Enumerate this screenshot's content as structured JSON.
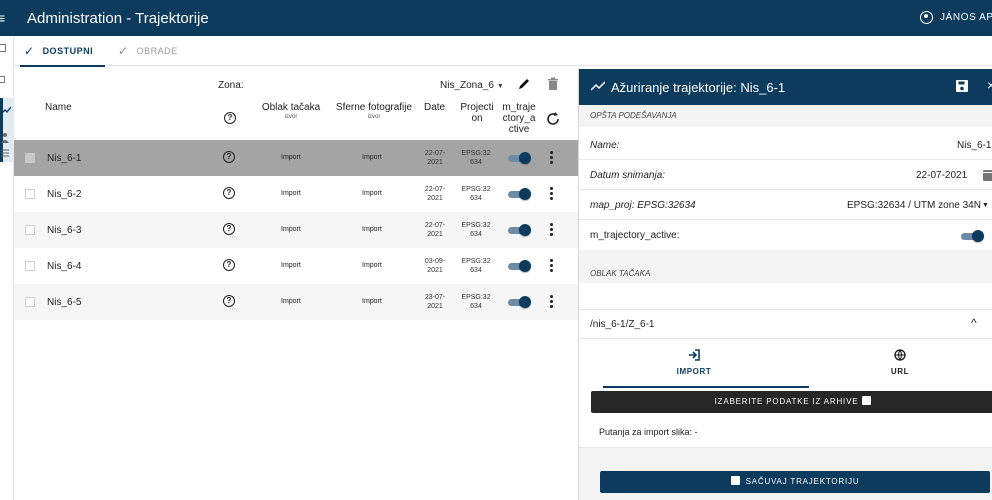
{
  "app": {
    "title": "Administration - Trajektorije",
    "user": "JÁNOS APR",
    "menu_icon": "≡"
  },
  "tabs": [
    {
      "label": "DOSTUPNI",
      "active": true
    },
    {
      "label": "OBRADE",
      "active": false
    }
  ],
  "table": {
    "zona_label": "Zona:",
    "zona_value": "Nis_Zona_6",
    "headers": {
      "name": "Name",
      "oblak": "Oblak tačaka",
      "oblak_sub": "izvor",
      "sferne": "Sferne fotografije",
      "sferne_sub": "izvor",
      "date": "Date",
      "projection": "Projecti on",
      "active": "m_traje ctory_a ctive"
    },
    "help_glyph": "?",
    "rows": [
      {
        "name": "Nis_6-1",
        "oblak": "Import",
        "sferne": "Import",
        "date_a": "22-07-",
        "date_b": "2021",
        "epsg_a": "EPSG:32",
        "epsg_b": "634",
        "active": true,
        "selected": true
      },
      {
        "name": "Nis_6-2",
        "oblak": "Import",
        "sferne": "Import",
        "date_a": "22-07-",
        "date_b": "2021",
        "epsg_a": "EPSG:32",
        "epsg_b": "634",
        "active": true
      },
      {
        "name": "Nis_6-3",
        "oblak": "Import",
        "sferne": "Import",
        "date_a": "22-07-",
        "date_b": "2021",
        "epsg_a": "EPSG:32",
        "epsg_b": "634",
        "active": true
      },
      {
        "name": "Nis_6-4",
        "oblak": "Import",
        "sferne": "Import",
        "date_a": "03-09-",
        "date_b": "2021",
        "epsg_a": "EPSG:32",
        "epsg_b": "634",
        "active": true
      },
      {
        "name": "Nis_6-5",
        "oblak": "Import",
        "sferne": "Import",
        "date_a": "23-07-",
        "date_b": "2021",
        "epsg_a": "EPSG:32",
        "epsg_b": "634",
        "active": true
      }
    ]
  },
  "panel": {
    "title": "Ažuriranje trajektorije: Nis_6-1",
    "close_glyph": "×",
    "section_general": "OPŠTA PODEŠAVANJA",
    "fields": {
      "name_label": "Name:",
      "name_value": "Nis_6-1",
      "date_label": "Datum snimanja:",
      "date_value": "22-07-2021",
      "proj_label": "map_proj: EPSG:32634",
      "proj_value": "EPSG:32634 / UTM zone 34N",
      "active_label": "m_trajectory_active:"
    },
    "section_cloud": "OBLAK TAČAKA",
    "cloud_path": "/nis_6-1/Z_6-1",
    "subtabs": {
      "import": "IMPORT",
      "url": "URL"
    },
    "choose_button": "IZABERITE PODATKE IZ ARHIVE",
    "import_path_label": "Putanja za import slika: -",
    "save_button": "SAČUVAJ TRAJEKTORIJU"
  },
  "colors": {
    "primary": "#0d3b5e",
    "selected_row": "#a4a4a4",
    "toggle_track": "#6d8aa6",
    "dark_button": "#262626"
  }
}
